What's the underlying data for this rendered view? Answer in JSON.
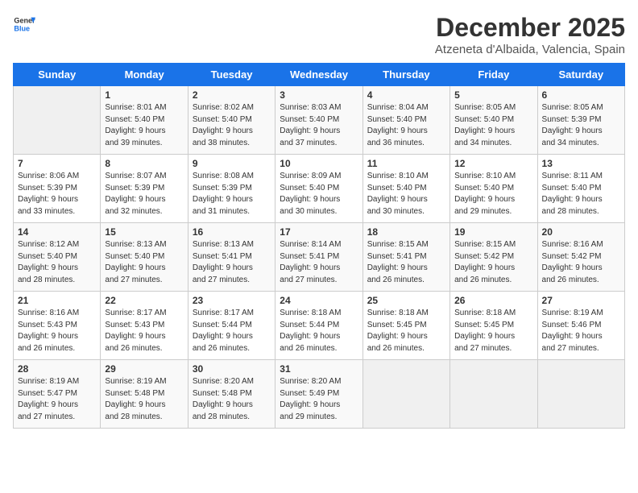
{
  "logo": {
    "line1": "General",
    "line2": "Blue"
  },
  "title": "December 2025",
  "location": "Atzeneta d'Albaida, Valencia, Spain",
  "days_of_week": [
    "Sunday",
    "Monday",
    "Tuesday",
    "Wednesday",
    "Thursday",
    "Friday",
    "Saturday"
  ],
  "weeks": [
    [
      {
        "num": "",
        "info": ""
      },
      {
        "num": "1",
        "info": "Sunrise: 8:01 AM\nSunset: 5:40 PM\nDaylight: 9 hours\nand 39 minutes."
      },
      {
        "num": "2",
        "info": "Sunrise: 8:02 AM\nSunset: 5:40 PM\nDaylight: 9 hours\nand 38 minutes."
      },
      {
        "num": "3",
        "info": "Sunrise: 8:03 AM\nSunset: 5:40 PM\nDaylight: 9 hours\nand 37 minutes."
      },
      {
        "num": "4",
        "info": "Sunrise: 8:04 AM\nSunset: 5:40 PM\nDaylight: 9 hours\nand 36 minutes."
      },
      {
        "num": "5",
        "info": "Sunrise: 8:05 AM\nSunset: 5:40 PM\nDaylight: 9 hours\nand 34 minutes."
      },
      {
        "num": "6",
        "info": "Sunrise: 8:05 AM\nSunset: 5:39 PM\nDaylight: 9 hours\nand 34 minutes."
      }
    ],
    [
      {
        "num": "7",
        "info": "Sunrise: 8:06 AM\nSunset: 5:39 PM\nDaylight: 9 hours\nand 33 minutes."
      },
      {
        "num": "8",
        "info": "Sunrise: 8:07 AM\nSunset: 5:39 PM\nDaylight: 9 hours\nand 32 minutes."
      },
      {
        "num": "9",
        "info": "Sunrise: 8:08 AM\nSunset: 5:39 PM\nDaylight: 9 hours\nand 31 minutes."
      },
      {
        "num": "10",
        "info": "Sunrise: 8:09 AM\nSunset: 5:40 PM\nDaylight: 9 hours\nand 30 minutes."
      },
      {
        "num": "11",
        "info": "Sunrise: 8:10 AM\nSunset: 5:40 PM\nDaylight: 9 hours\nand 30 minutes."
      },
      {
        "num": "12",
        "info": "Sunrise: 8:10 AM\nSunset: 5:40 PM\nDaylight: 9 hours\nand 29 minutes."
      },
      {
        "num": "13",
        "info": "Sunrise: 8:11 AM\nSunset: 5:40 PM\nDaylight: 9 hours\nand 28 minutes."
      }
    ],
    [
      {
        "num": "14",
        "info": "Sunrise: 8:12 AM\nSunset: 5:40 PM\nDaylight: 9 hours\nand 28 minutes."
      },
      {
        "num": "15",
        "info": "Sunrise: 8:13 AM\nSunset: 5:40 PM\nDaylight: 9 hours\nand 27 minutes."
      },
      {
        "num": "16",
        "info": "Sunrise: 8:13 AM\nSunset: 5:41 PM\nDaylight: 9 hours\nand 27 minutes."
      },
      {
        "num": "17",
        "info": "Sunrise: 8:14 AM\nSunset: 5:41 PM\nDaylight: 9 hours\nand 27 minutes."
      },
      {
        "num": "18",
        "info": "Sunrise: 8:15 AM\nSunset: 5:41 PM\nDaylight: 9 hours\nand 26 minutes."
      },
      {
        "num": "19",
        "info": "Sunrise: 8:15 AM\nSunset: 5:42 PM\nDaylight: 9 hours\nand 26 minutes."
      },
      {
        "num": "20",
        "info": "Sunrise: 8:16 AM\nSunset: 5:42 PM\nDaylight: 9 hours\nand 26 minutes."
      }
    ],
    [
      {
        "num": "21",
        "info": "Sunrise: 8:16 AM\nSunset: 5:43 PM\nDaylight: 9 hours\nand 26 minutes."
      },
      {
        "num": "22",
        "info": "Sunrise: 8:17 AM\nSunset: 5:43 PM\nDaylight: 9 hours\nand 26 minutes."
      },
      {
        "num": "23",
        "info": "Sunrise: 8:17 AM\nSunset: 5:44 PM\nDaylight: 9 hours\nand 26 minutes."
      },
      {
        "num": "24",
        "info": "Sunrise: 8:18 AM\nSunset: 5:44 PM\nDaylight: 9 hours\nand 26 minutes."
      },
      {
        "num": "25",
        "info": "Sunrise: 8:18 AM\nSunset: 5:45 PM\nDaylight: 9 hours\nand 26 minutes."
      },
      {
        "num": "26",
        "info": "Sunrise: 8:18 AM\nSunset: 5:45 PM\nDaylight: 9 hours\nand 27 minutes."
      },
      {
        "num": "27",
        "info": "Sunrise: 8:19 AM\nSunset: 5:46 PM\nDaylight: 9 hours\nand 27 minutes."
      }
    ],
    [
      {
        "num": "28",
        "info": "Sunrise: 8:19 AM\nSunset: 5:47 PM\nDaylight: 9 hours\nand 27 minutes."
      },
      {
        "num": "29",
        "info": "Sunrise: 8:19 AM\nSunset: 5:48 PM\nDaylight: 9 hours\nand 28 minutes."
      },
      {
        "num": "30",
        "info": "Sunrise: 8:20 AM\nSunset: 5:48 PM\nDaylight: 9 hours\nand 28 minutes."
      },
      {
        "num": "31",
        "info": "Sunrise: 8:20 AM\nSunset: 5:49 PM\nDaylight: 9 hours\nand 29 minutes."
      },
      {
        "num": "",
        "info": ""
      },
      {
        "num": "",
        "info": ""
      },
      {
        "num": "",
        "info": ""
      }
    ]
  ]
}
